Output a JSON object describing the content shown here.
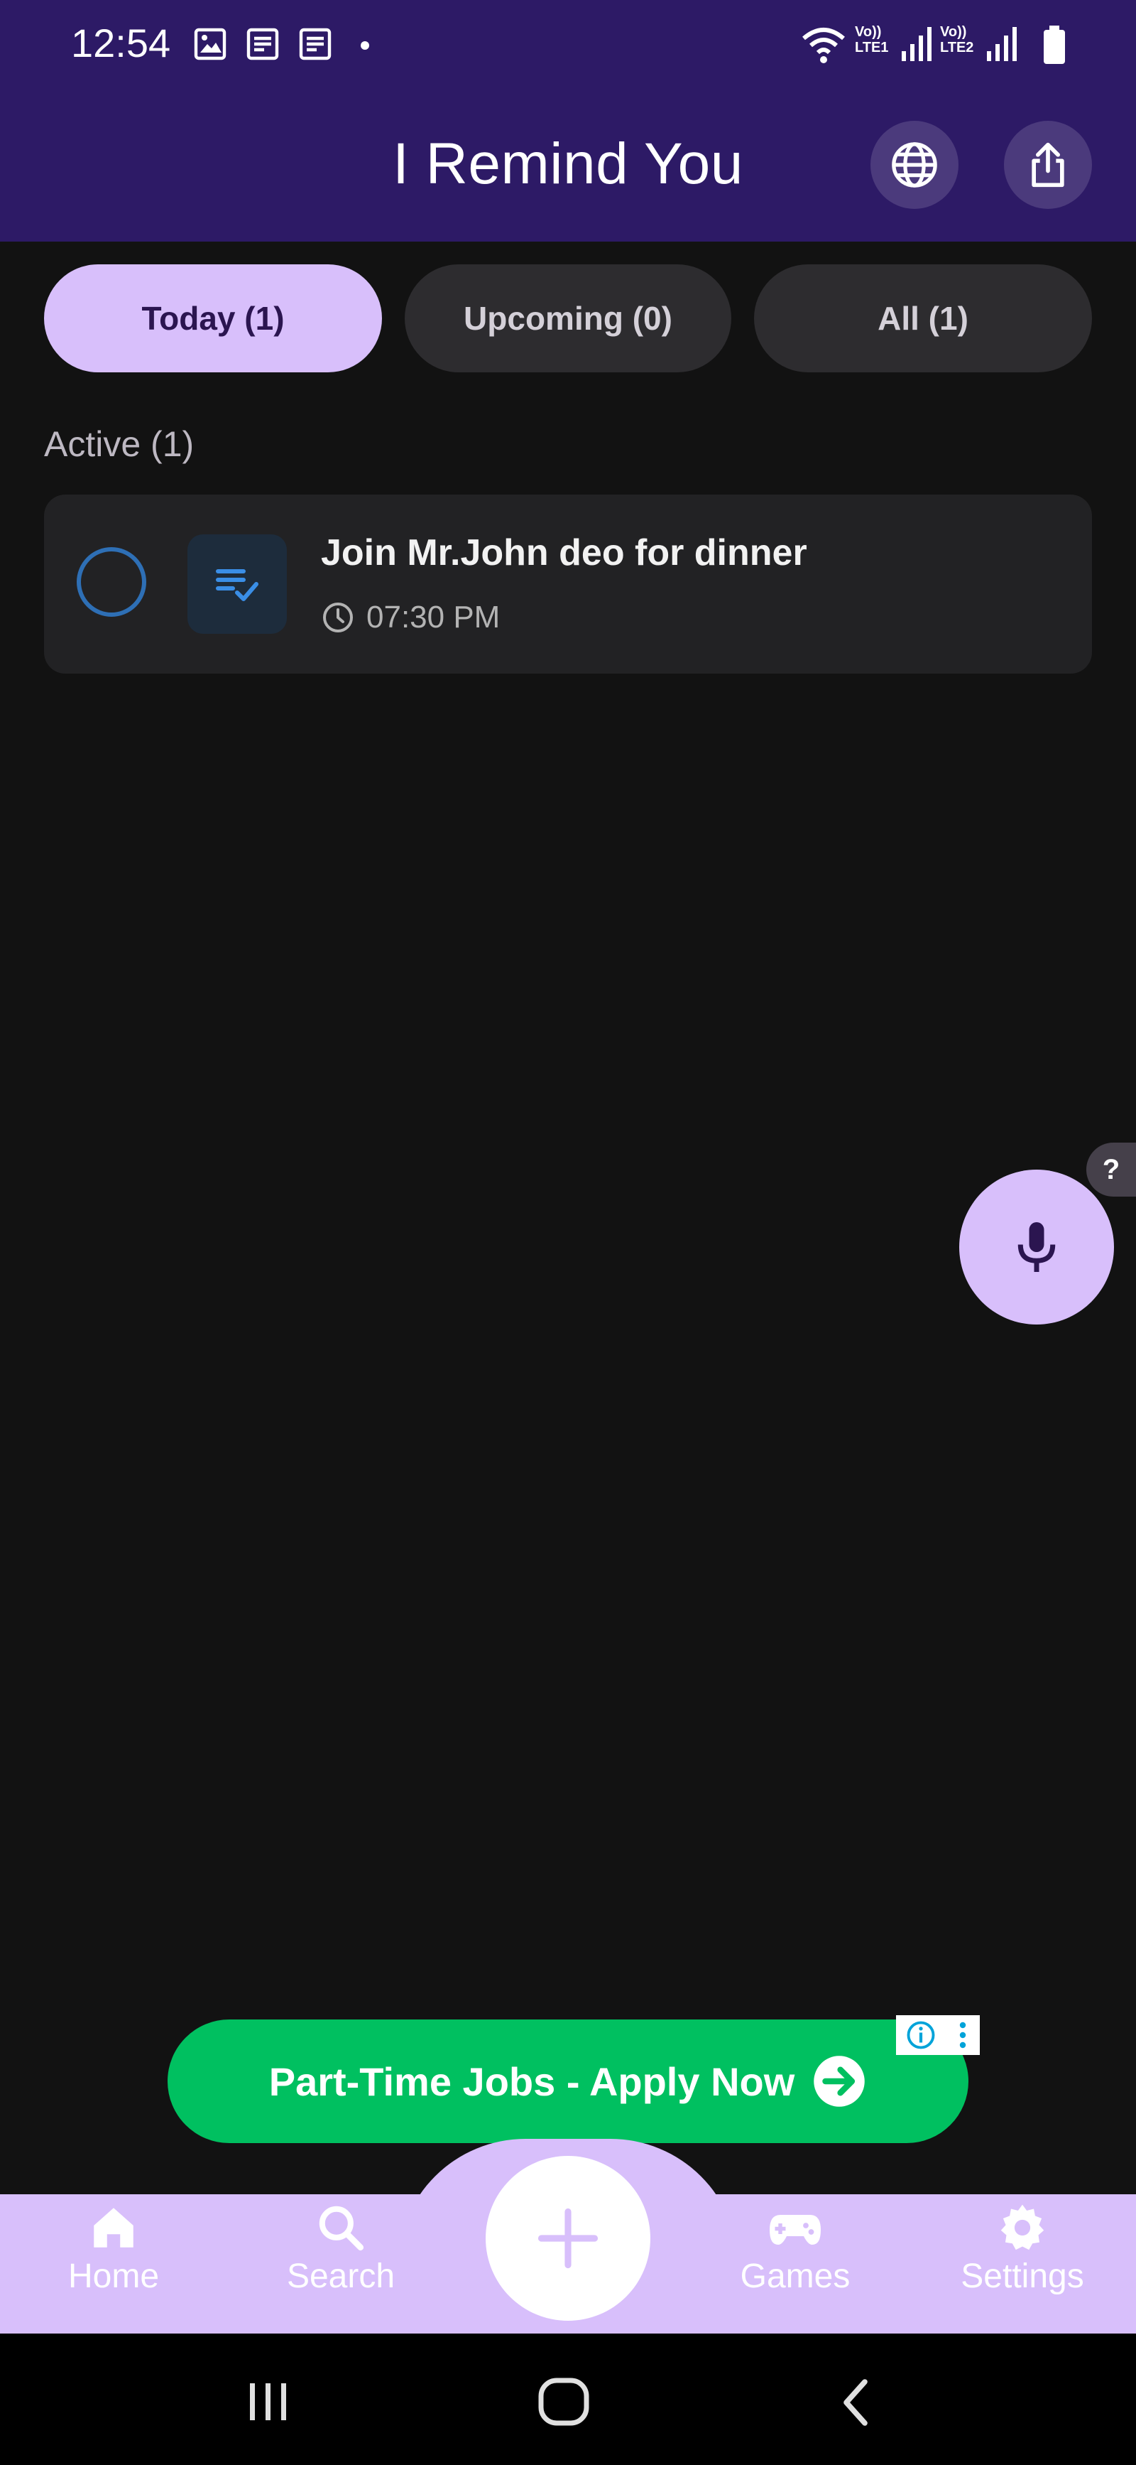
{
  "status_bar": {
    "time": "12:54",
    "sim1_label": "Vo)) LTE1",
    "sim2_label": "Vo)) LTE2"
  },
  "app_bar": {
    "title": "I Remind You",
    "language_icon": "globe-icon",
    "share_icon": "share-icon"
  },
  "tabs": [
    {
      "label": "Today (1)",
      "selected": true
    },
    {
      "label": "Upcoming (0)",
      "selected": false
    },
    {
      "label": "All (1)",
      "selected": false
    }
  ],
  "section": {
    "label": "Active (1)"
  },
  "reminders": [
    {
      "title": "Join Mr.John deo for dinner",
      "time": "07:30 PM",
      "icon": "checklist-icon",
      "completed": false
    }
  ],
  "voice": {
    "help_label": "?",
    "icon": "mic-icon"
  },
  "ad": {
    "text": "Part-Time Jobs - Apply Now"
  },
  "bottom_nav": {
    "items": [
      {
        "label": "Home",
        "icon": "home-icon"
      },
      {
        "label": "Search",
        "icon": "search-icon"
      },
      {
        "label": "Games",
        "icon": "gamepad-icon"
      },
      {
        "label": "Settings",
        "icon": "gear-icon"
      }
    ],
    "add_icon": "plus-icon"
  },
  "colors": {
    "app_bar": "#2d1a66",
    "accent": "#d8bffb",
    "background": "#121212",
    "card": "#222224",
    "ad_green": "#00c060"
  }
}
